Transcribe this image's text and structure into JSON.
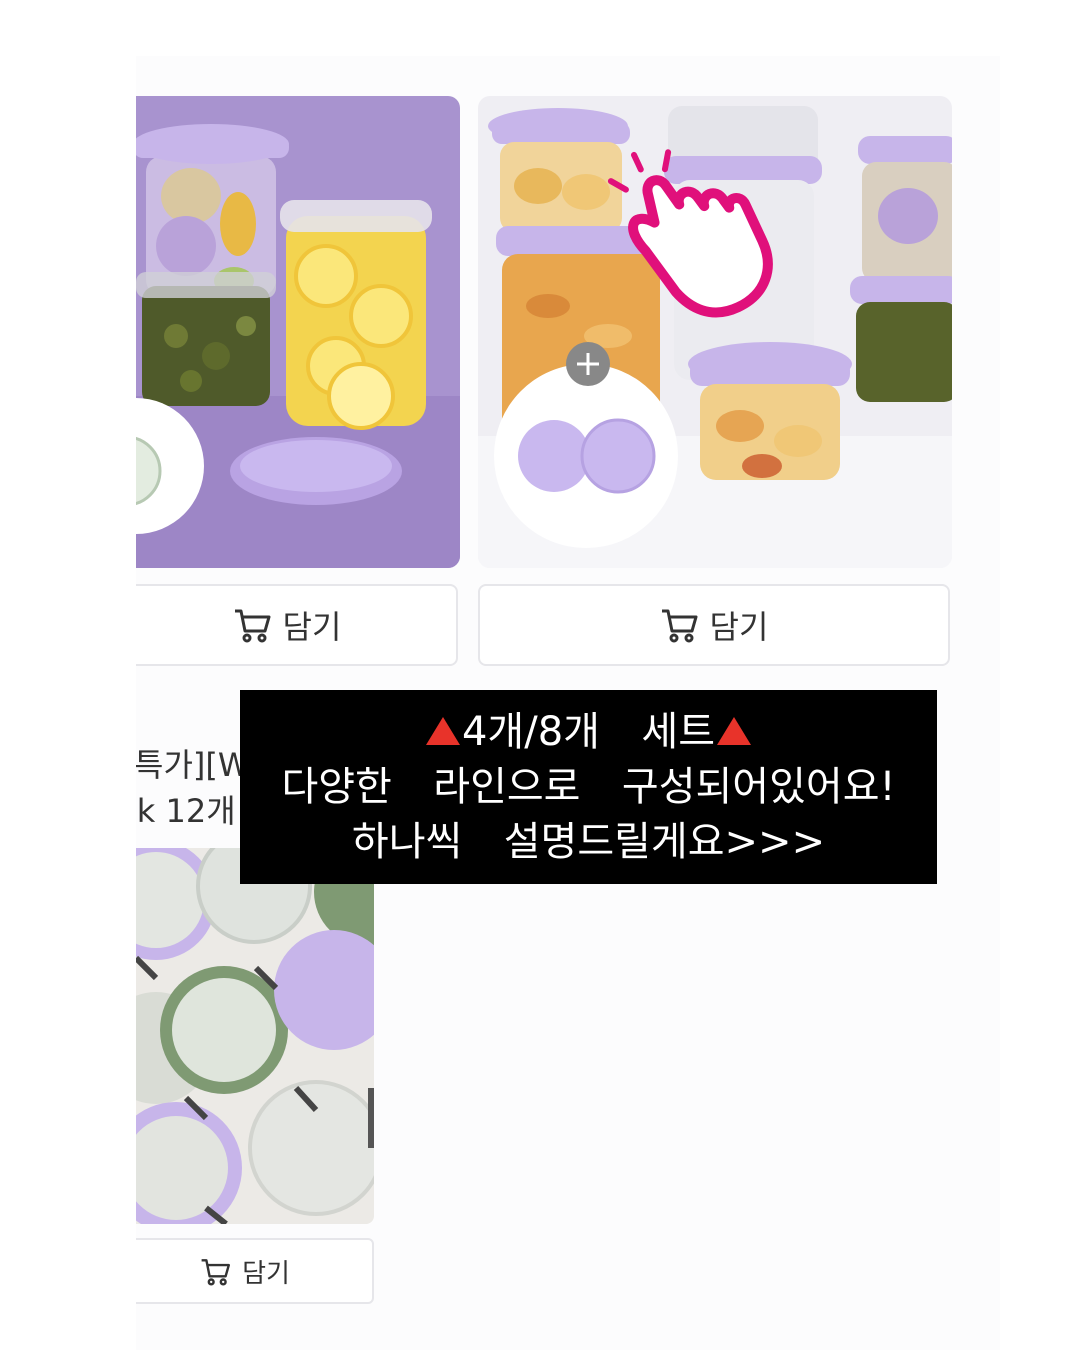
{
  "products": [
    {
      "cart_label": "담기"
    },
    {
      "cart_label": "담기"
    },
    {
      "title_line1": "특가][W",
      "title_line2": ":k 12개",
      "cart_label": "담기"
    }
  ],
  "caption": {
    "line1_main": "4개/8개  세트",
    "line2": "다양한  라인으로  구성되어있어요!",
    "line3": "하나씩  설명드릴게요>>>"
  },
  "colors": {
    "lavender_bg": "#a893cf",
    "lid_purple": "#c7b5ea",
    "tap_hand_pink": "#e0107b",
    "warning_triangle": "#e8332a"
  },
  "icons": [
    "cart-icon",
    "plus-icon",
    "tap-hand-icon",
    "warning-triangle-icon"
  ]
}
